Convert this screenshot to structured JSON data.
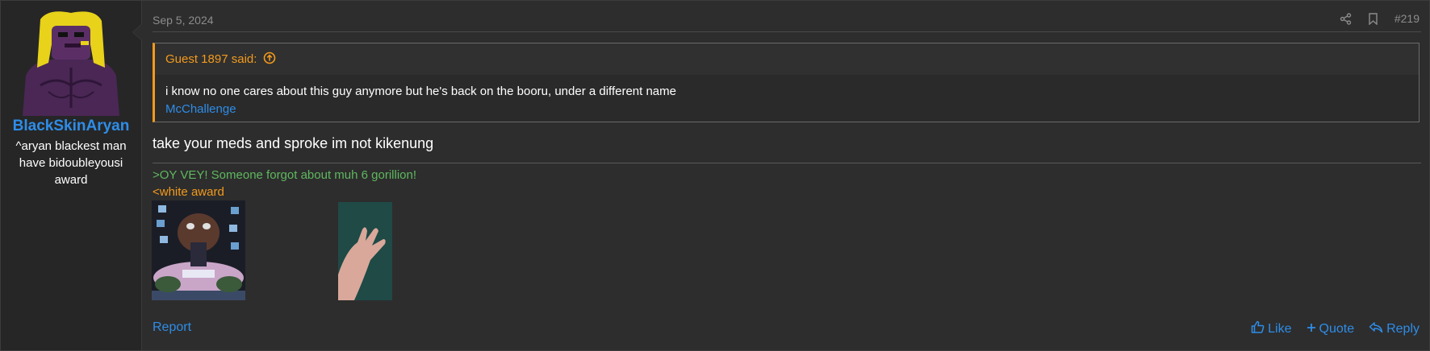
{
  "post": {
    "user": {
      "name": "BlackSkinAryan",
      "title": "^aryan blackest man have bidoubleyousi award"
    },
    "date": "Sep 5, 2024",
    "number": "#219",
    "quote": {
      "header": "Guest 1897 said:",
      "text": "i know no one cares about this guy anymore but he's back on the booru, under a different name",
      "link": "McChallenge"
    },
    "message": "take your meds and sproke im not kikenung",
    "signature": {
      "line1": ">OY VEY! Someone forgot about muh 6 gorillion!",
      "line2": "<white award"
    },
    "footer": {
      "report": "Report",
      "like": "Like",
      "quote": "Quote",
      "reply": "Reply"
    }
  },
  "colors": {
    "link": "#2e8de8",
    "quote_accent": "#f39a1c",
    "greentext": "#5fb85f",
    "background": "#2d2d2d"
  }
}
